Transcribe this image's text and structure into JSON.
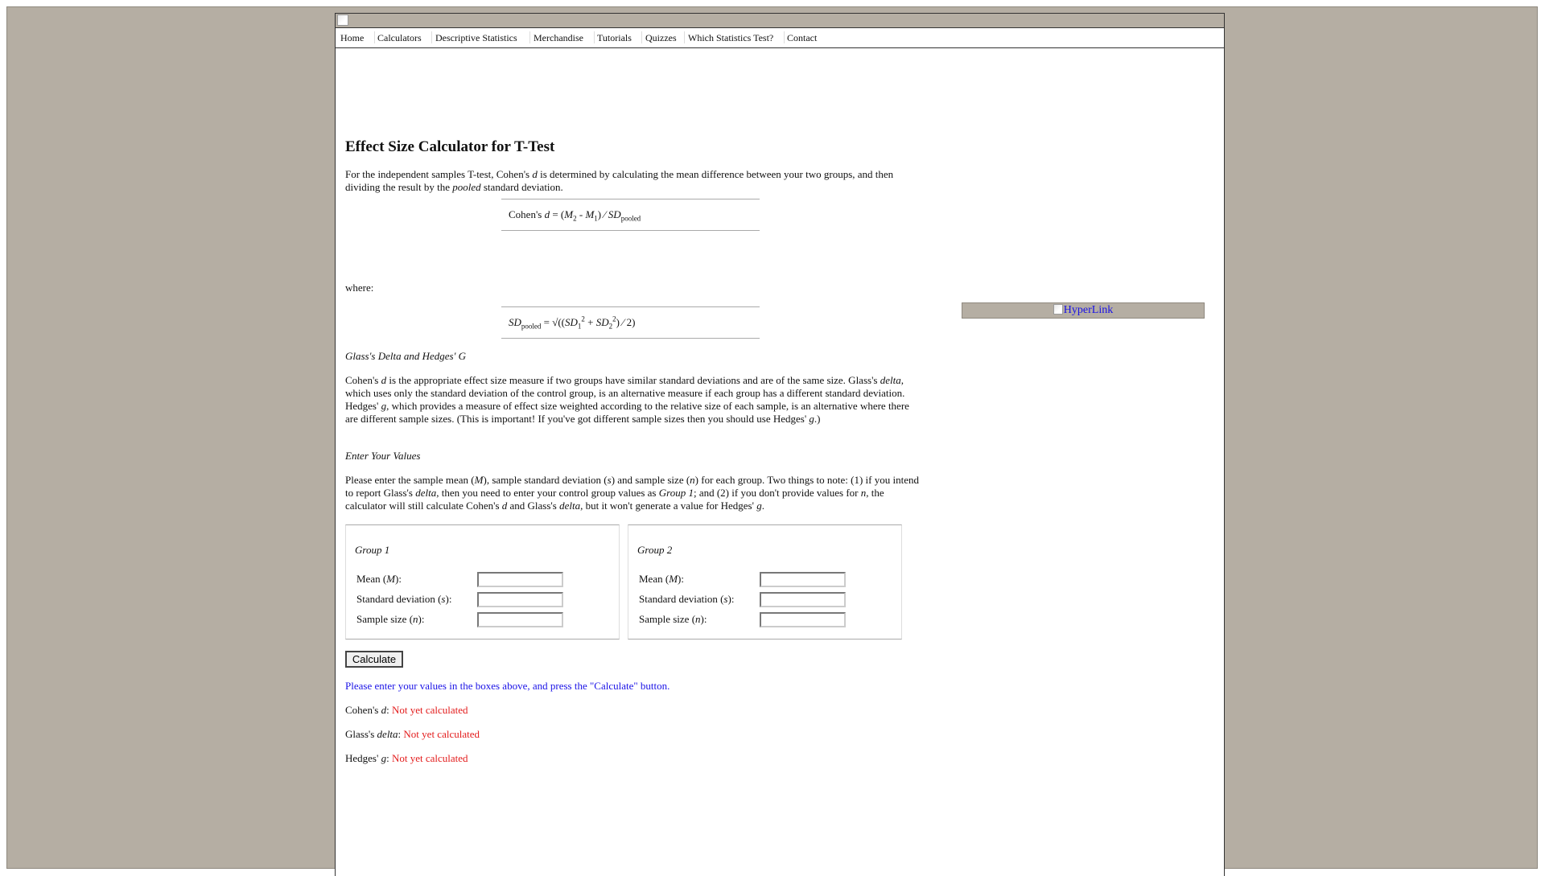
{
  "nav": {
    "items": [
      "Home",
      "Calculators",
      "Descriptive Statistics",
      "Merchandise",
      "Tutorials",
      "Quizzes",
      "Which Statistics Test?",
      "Contact"
    ]
  },
  "page_title": "Effect Size Calculator for T-Test",
  "intro": {
    "p1_a": "For the independent samples T-test, Cohen's ",
    "p1_d": "d",
    "p1_b": " is determined by calculating the mean difference between your two groups, and then dividing the result by the ",
    "p1_pooled": "pooled",
    "p1_c": " standard deviation."
  },
  "formula1": {
    "prefix": "Cohen's ",
    "d": "d",
    "eq": " = (",
    "m2": "M",
    "m2sub": "2",
    "minus": " - ",
    "m1": "M",
    "m1sub": "1",
    "div": ") ⁄ ",
    "sd": "SD",
    "sdsub": "pooled"
  },
  "where_label": "where:",
  "formula2": {
    "sd": "SD",
    "sdsub": "pooled",
    "eq": " = √((",
    "sd1": "SD",
    "sd1sub": "1",
    "sup1": "2",
    "plus": " + ",
    "sd2": "SD",
    "sd2sub": "2",
    "sup2": "2",
    "tail": ") ⁄ 2)"
  },
  "section_glass_title": "Glass's Delta and Hedges' G",
  "glass_para": {
    "a": "Cohen's ",
    "d": "d",
    "b": " is the appropriate effect size measure if two groups have similar standard deviations and are of the same size. Glass's ",
    "delta": "delta",
    "c": ", which uses only the standard deviation of the control group, is an alternative measure if each group has a different standard deviation. Hedges' ",
    "g": "g",
    "e": ", which provides a measure of effect size weighted according to the relative size of each sample, is an alternative where there are different sample sizes. (This is important! If you've got different sample sizes then you should use Hedges' ",
    "g2": "g",
    "f": ".)"
  },
  "section_enter_title": "Enter Your Values",
  "enter_para": {
    "a": "Please enter the sample mean (",
    "M": "M",
    "b": "), sample standard deviation (",
    "s": "s",
    "c": ") and sample size (",
    "n": "n",
    "d": ") for each group. Two things to note: (1) if you intend to report Glass's ",
    "delta": "delta",
    "e": ", then you need to enter your control group values as ",
    "group1": "Group 1",
    "f": "; and (2) if you don't provide values for ",
    "n2": "n",
    "g": ", the calculator will still calculate Cohen's ",
    "dd": "d",
    "h": " and Glass's ",
    "delta2": "delta",
    "i": ", but it won't generate a value for Hedges' ",
    "gg": "g",
    "j": "."
  },
  "groups": [
    {
      "title": "Group 1",
      "mean_label_a": "Mean (",
      "mean_label_v": "M",
      "mean_label_b": "):",
      "sd_label_a": "Standard deviation (",
      "sd_label_v": "s",
      "sd_label_b": "):",
      "n_label_a": "Sample size (",
      "n_label_v": "n",
      "n_label_b": "):",
      "mean_value": "",
      "sd_value": "",
      "n_value": ""
    },
    {
      "title": "Group 2",
      "mean_label_a": "Mean (",
      "mean_label_v": "M",
      "mean_label_b": "):",
      "sd_label_a": "Standard deviation (",
      "sd_label_v": "s",
      "sd_label_b": "):",
      "n_label_a": "Sample size (",
      "n_label_v": "n",
      "n_label_b": "):",
      "mean_value": "",
      "sd_value": "",
      "n_value": ""
    }
  ],
  "calculate_label": "Calculate",
  "prompt_message": "Please enter your values in the boxes above, and press the \"Calculate\" button.",
  "results": {
    "cohen_a": "Cohen's ",
    "cohen_v": "d",
    "cohen_b": ": ",
    "cohen_value": "Not yet calculated",
    "glass_a": "Glass's ",
    "glass_v": "delta",
    "glass_b": ": ",
    "glass_value": "Not yet calculated",
    "hedges_a": "Hedges' ",
    "hedges_v": "g",
    "hedges_b": ": ",
    "hedges_value": "Not yet calculated"
  },
  "sidebar": {
    "link_text": "HyperLink"
  },
  "colors": {
    "background": "#b5aea3",
    "link_blue": "#1a12e6",
    "result_red": "#e31c1c"
  },
  "icons": {
    "banner": "broken-image-icon",
    "sidebar": "broken-image-icon"
  }
}
